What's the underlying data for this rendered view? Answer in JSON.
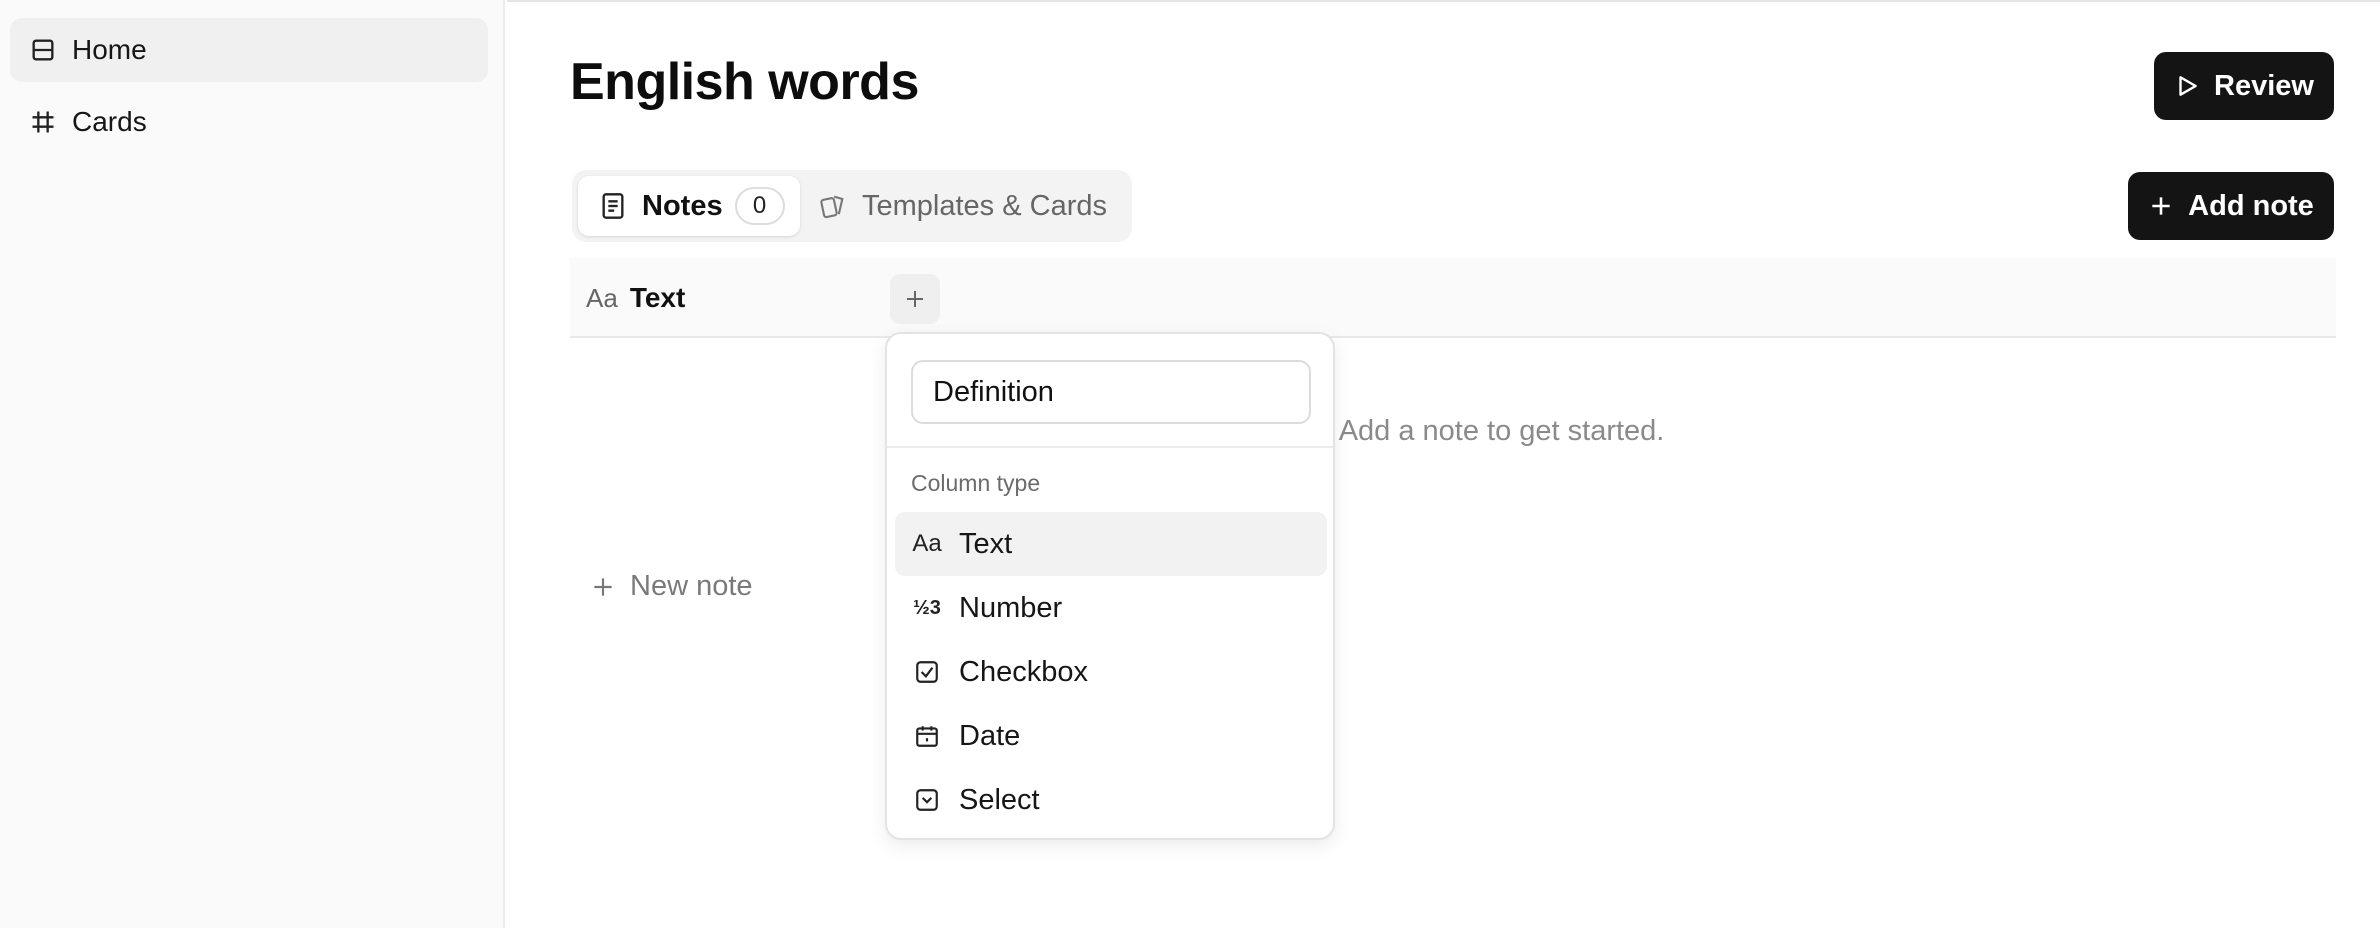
{
  "sidebar": {
    "items": [
      {
        "label": "Home",
        "icon": "layout-icon"
      },
      {
        "label": "Cards",
        "icon": "hash-icon"
      }
    ]
  },
  "page": {
    "title": "English words"
  },
  "toolbar": {
    "review_label": "Review",
    "add_note_label": "Add note"
  },
  "tabs": {
    "notes_label": "Notes",
    "notes_count": "0",
    "templates_label": "Templates & Cards"
  },
  "table": {
    "column_icon": "Aa",
    "column_label": "Text",
    "empty_text": "et. Add a note to get started.",
    "new_note_label": "New note"
  },
  "popover": {
    "name_value": "Definition",
    "section_label": "Column type",
    "options": [
      {
        "label": "Text",
        "icon": "text-type-icon",
        "glyph": "Aa"
      },
      {
        "label": "Number",
        "icon": "number-type-icon",
        "glyph": "½3"
      },
      {
        "label": "Checkbox",
        "icon": "checkbox-icon"
      },
      {
        "label": "Date",
        "icon": "calendar-icon"
      },
      {
        "label": "Select",
        "icon": "select-icon"
      }
    ]
  },
  "colors": {
    "dark_button": "#141414",
    "sidebar_bg": "#fafafa",
    "muted_text": "#8a8a8a"
  }
}
